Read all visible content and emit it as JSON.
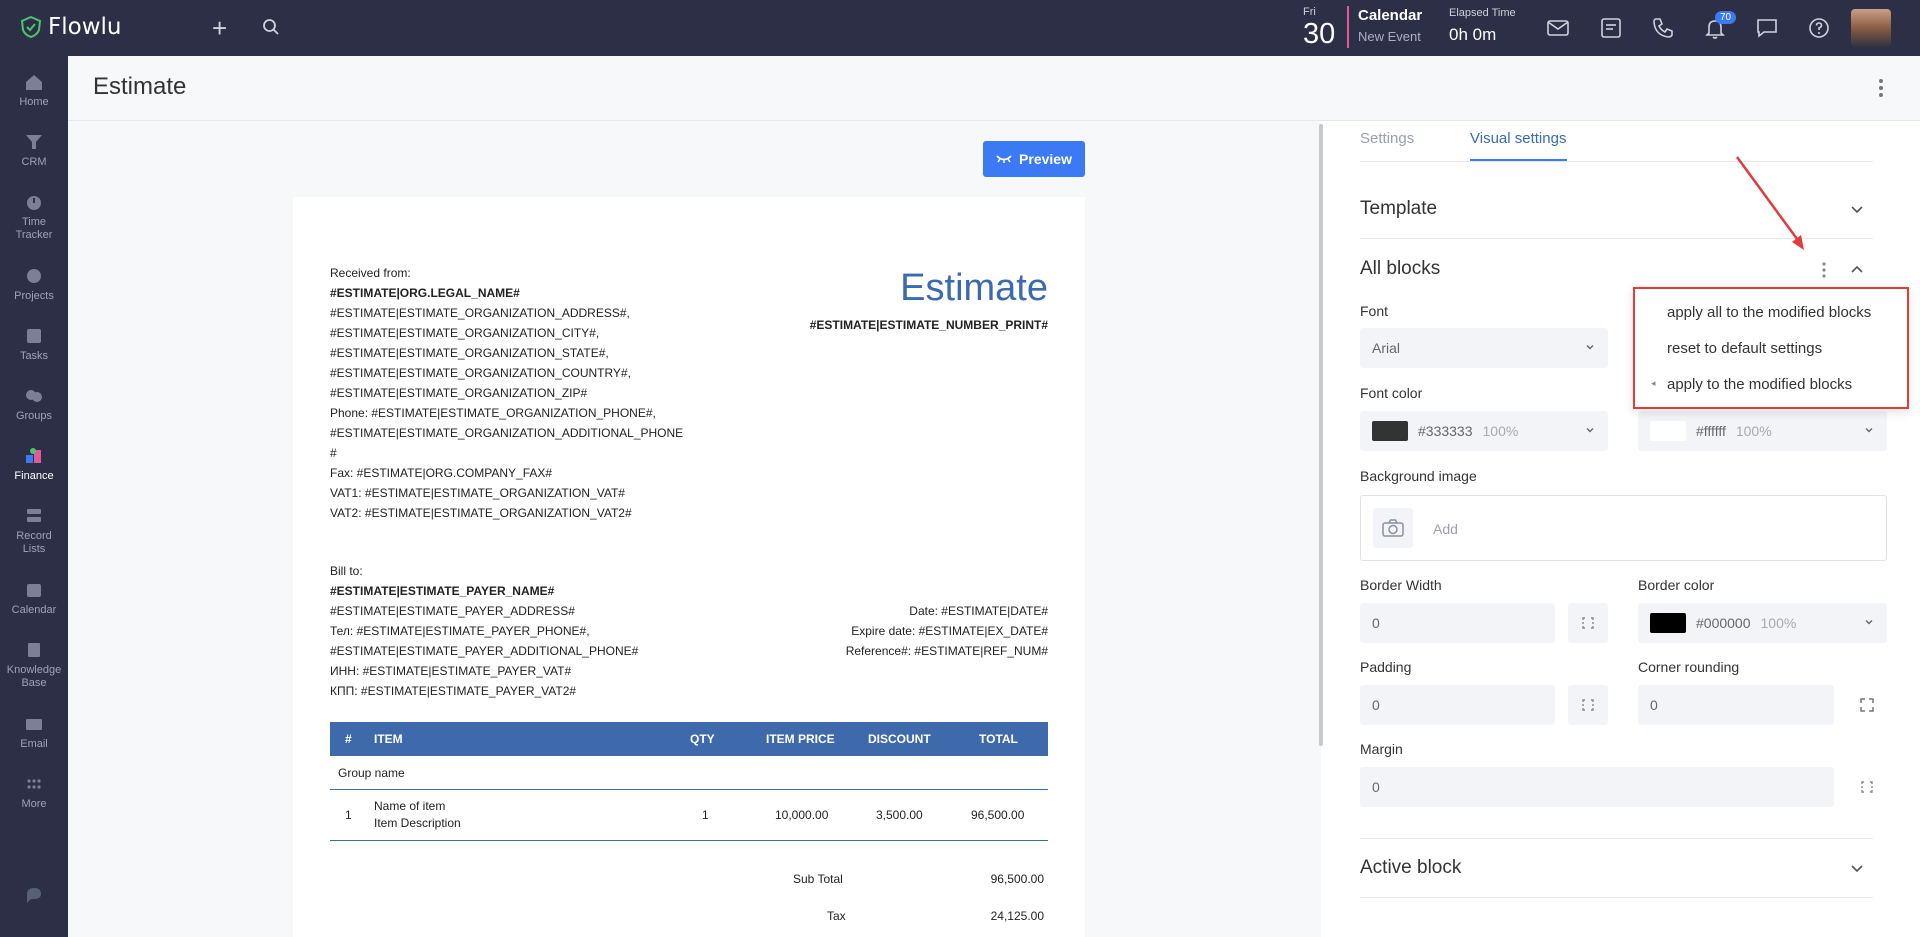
{
  "app": {
    "name": "Flowlu"
  },
  "topbar": {
    "date_dow": "Fri",
    "date_day": "30",
    "calendar_title": "Calendar",
    "calendar_sub": "New Event",
    "elapsed_label": "Elapsed Time",
    "elapsed_value": "0h 0m",
    "notification_count": "70"
  },
  "sidebar": {
    "items": [
      {
        "label": "Home",
        "icon": "home-icon"
      },
      {
        "label": "CRM",
        "icon": "crm-icon"
      },
      {
        "label": "Time Tracker",
        "icon": "time-tracker-icon"
      },
      {
        "label": "Projects",
        "icon": "projects-icon"
      },
      {
        "label": "Tasks",
        "icon": "tasks-icon"
      },
      {
        "label": "Groups",
        "icon": "groups-icon"
      },
      {
        "label": "Finance",
        "icon": "finance-icon",
        "active": true
      },
      {
        "label": "Record Lists",
        "icon": "record-lists-icon"
      },
      {
        "label": "Calendar",
        "icon": "calendar-icon"
      },
      {
        "label": "Knowledge Base",
        "icon": "knowledge-base-icon"
      },
      {
        "label": "Email",
        "icon": "email-icon"
      },
      {
        "label": "More",
        "icon": "more-icon"
      }
    ]
  },
  "page": {
    "title": "Estimate"
  },
  "preview": {
    "label": "Preview"
  },
  "doc": {
    "received_from": "Received from:",
    "org_legal_name": "#ESTIMATE|ORG.LEGAL_NAME#",
    "org_lines": [
      "#ESTIMATE|ESTIMATE_ORGANIZATION_ADDRESS#,",
      "#ESTIMATE|ESTIMATE_ORGANIZATION_CITY#,",
      "#ESTIMATE|ESTIMATE_ORGANIZATION_STATE#,",
      "#ESTIMATE|ESTIMATE_ORGANIZATION_COUNTRY#,",
      "#ESTIMATE|ESTIMATE_ORGANIZATION_ZIP#",
      "Phone: #ESTIMATE|ESTIMATE_ORGANIZATION_PHONE#,",
      "#ESTIMATE|ESTIMATE_ORGANIZATION_ADDITIONAL_PHONE",
      "#",
      "Fax: #ESTIMATE|ORG.COMPANY_FAX#",
      "VAT1: #ESTIMATE|ESTIMATE_ORGANIZATION_VAT#",
      "VAT2: #ESTIMATE|ESTIMATE_ORGANIZATION_VAT2#"
    ],
    "title": "Estimate",
    "number_print": "#ESTIMATE|ESTIMATE_NUMBER_PRINT#",
    "bill_to": "Bill to:",
    "payer_name": "#ESTIMATE|ESTIMATE_PAYER_NAME#",
    "payer_lines": [
      "#ESTIMATE|ESTIMATE_PAYER_ADDRESS#",
      "Тел: #ESTIMATE|ESTIMATE_PAYER_PHONE#,",
      "#ESTIMATE|ESTIMATE_PAYER_ADDITIONAL_PHONE#",
      "ИНН: #ESTIMATE|ESTIMATE_PAYER_VAT#",
      "КПП: #ESTIMATE|ESTIMATE_PAYER_VAT2#"
    ],
    "date_line": "Date: #ESTIMATE|DATE#",
    "expire_line": "Expire date: #ESTIMATE|EX_DATE#",
    "reference_line": "Reference#: #ESTIMATE|REF_NUM#",
    "table": {
      "headers": [
        "#",
        "ITEM",
        "QTY",
        "ITEM PRICE",
        "DISCOUNT",
        "TOTAL"
      ],
      "group_name": "Group name",
      "row": {
        "num": "1",
        "item": "Name of item",
        "desc": "Item Description",
        "qty": "1",
        "price": "10,000.00",
        "discount": "3,500.00",
        "total": "96,500.00"
      }
    },
    "subtotal_label": "Sub Total",
    "subtotal_value": "96,500.00",
    "tax_label": "Tax",
    "tax_value": "24,125.00"
  },
  "panel": {
    "tabs": [
      "Settings",
      "Visual settings"
    ],
    "template": "Template",
    "all_blocks": "All blocks",
    "font_label": "Font",
    "font_value": "Arial",
    "font_color_label": "Font color",
    "font_color": {
      "value": "#333333",
      "pct": "100%",
      "hex": "#333333"
    },
    "bg_color": {
      "value": "#ffffff",
      "pct": "100%",
      "hex": "#ffffff"
    },
    "bg_image_label": "Background image",
    "bg_image_add": "Add",
    "border_width_label": "Border Width",
    "border_width_value": "0",
    "border_color_label": "Border color",
    "border_color": {
      "value": "#000000",
      "pct": "100%",
      "hex": "#000000"
    },
    "padding_label": "Padding",
    "padding_value": "0",
    "corner_label": "Corner rounding",
    "corner_value": "0",
    "margin_label": "Margin",
    "margin_value": "0",
    "active_block": "Active block"
  },
  "popup": {
    "items": [
      "apply all to the modified blocks",
      "reset to default settings",
      "apply to the modified blocks"
    ]
  },
  "colors": {
    "accent": "#3b79f5",
    "topbar": "#2c2f45",
    "highlight": "#e03c3c"
  }
}
